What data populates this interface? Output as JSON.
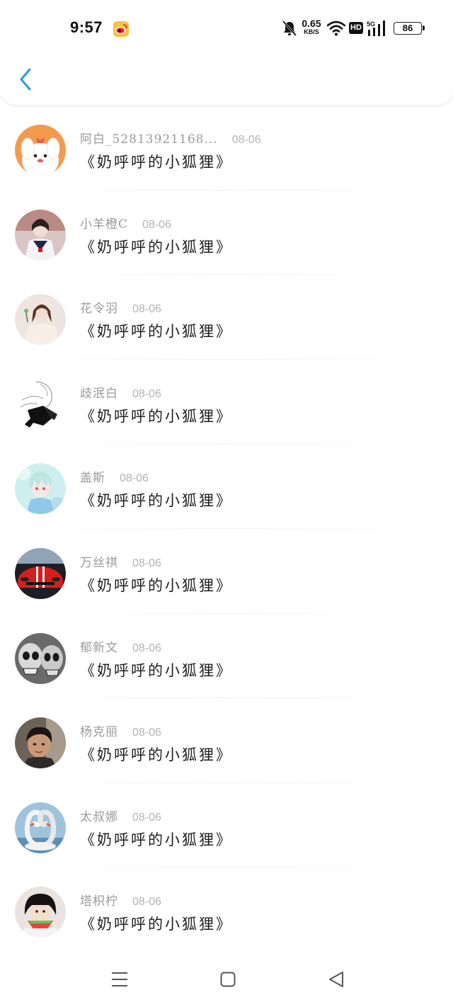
{
  "status_bar": {
    "time": "9:57",
    "net_speed_value": "0.65",
    "net_speed_unit": "KB/S",
    "hd_label": "HD",
    "signal_label": "5G",
    "battery_level": "86"
  },
  "header": {
    "back_icon": "chevron-left-icon",
    "accent_color": "#2a9ae0"
  },
  "comments": [
    {
      "username": "阿白_52813921168...",
      "date": "08-06",
      "text": "《奶呼呼的小狐狸》",
      "avatar": "cartoon-dog"
    },
    {
      "username": "小羊橙C",
      "date": "08-06",
      "text": "《奶呼呼的小狐狸》",
      "avatar": "girl-sailor"
    },
    {
      "username": "花令羽",
      "date": "08-06",
      "text": "《奶呼呼的小狐狸》",
      "avatar": "girl-light"
    },
    {
      "username": "歧泯白",
      "date": "08-06",
      "text": "《奶呼呼的小狐狸》",
      "avatar": "sketch-figure"
    },
    {
      "username": "盖斯",
      "date": "08-06",
      "text": "《奶呼呼的小狐狸》",
      "avatar": "anime-boy"
    },
    {
      "username": "万丝祺",
      "date": "08-06",
      "text": "《奶呼呼的小狐狸》",
      "avatar": "red-car"
    },
    {
      "username": "郁新文",
      "date": "08-06",
      "text": "《奶呼呼的小狐狸》",
      "avatar": "skulls"
    },
    {
      "username": "杨克丽",
      "date": "08-06",
      "text": "《奶呼呼的小狐狸》",
      "avatar": "woman-portrait"
    },
    {
      "username": "太叔娜",
      "date": "08-06",
      "text": "《奶呼呼的小狐狸》",
      "avatar": "swans-heart"
    },
    {
      "username": "塔枳柠",
      "date": "08-06",
      "text": "《奶呼呼的小狐狸》",
      "avatar": "girl-watermelon"
    }
  ],
  "nav_bar": {
    "menu_icon": "menu-icon",
    "home_icon": "home-square-icon",
    "back_icon": "back-triangle-icon"
  }
}
